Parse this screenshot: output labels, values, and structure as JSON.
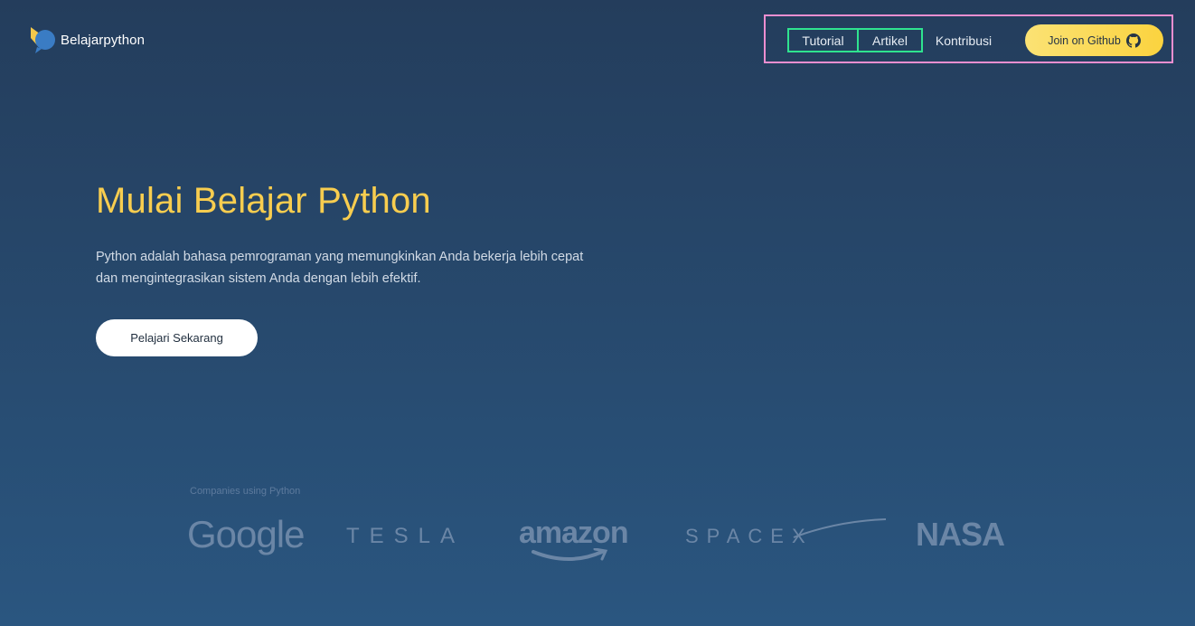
{
  "header": {
    "logo_text": "Belajarpython",
    "nav": [
      {
        "label": "Tutorial"
      },
      {
        "label": "Artikel"
      },
      {
        "label": "Kontribusi"
      }
    ],
    "github_button": {
      "label": "Join on Github",
      "icon": "github-icon"
    }
  },
  "hero": {
    "title": "Mulai Belajar Python",
    "description": "Python adalah bahasa pemrograman yang memungkinkan Anda bekerja lebih cepat dan mengintegrasikan sistem Anda dengan lebih efektif.",
    "cta_label": "Pelajari Sekarang"
  },
  "companies": {
    "label": "Companies using Python",
    "logos": [
      "Google",
      "TESLA",
      "amazon",
      "SPACEX",
      "NASA"
    ]
  },
  "colors": {
    "background_top": "#243d5c",
    "background_bottom": "#2a5680",
    "title_yellow": "#f8cd4f",
    "github_button_yellow": "#fbd33f",
    "nav_highlight_green": "#2fe38f",
    "nav_group_pink": "#ec8ed0",
    "logo_muted": "#6b86a6"
  }
}
